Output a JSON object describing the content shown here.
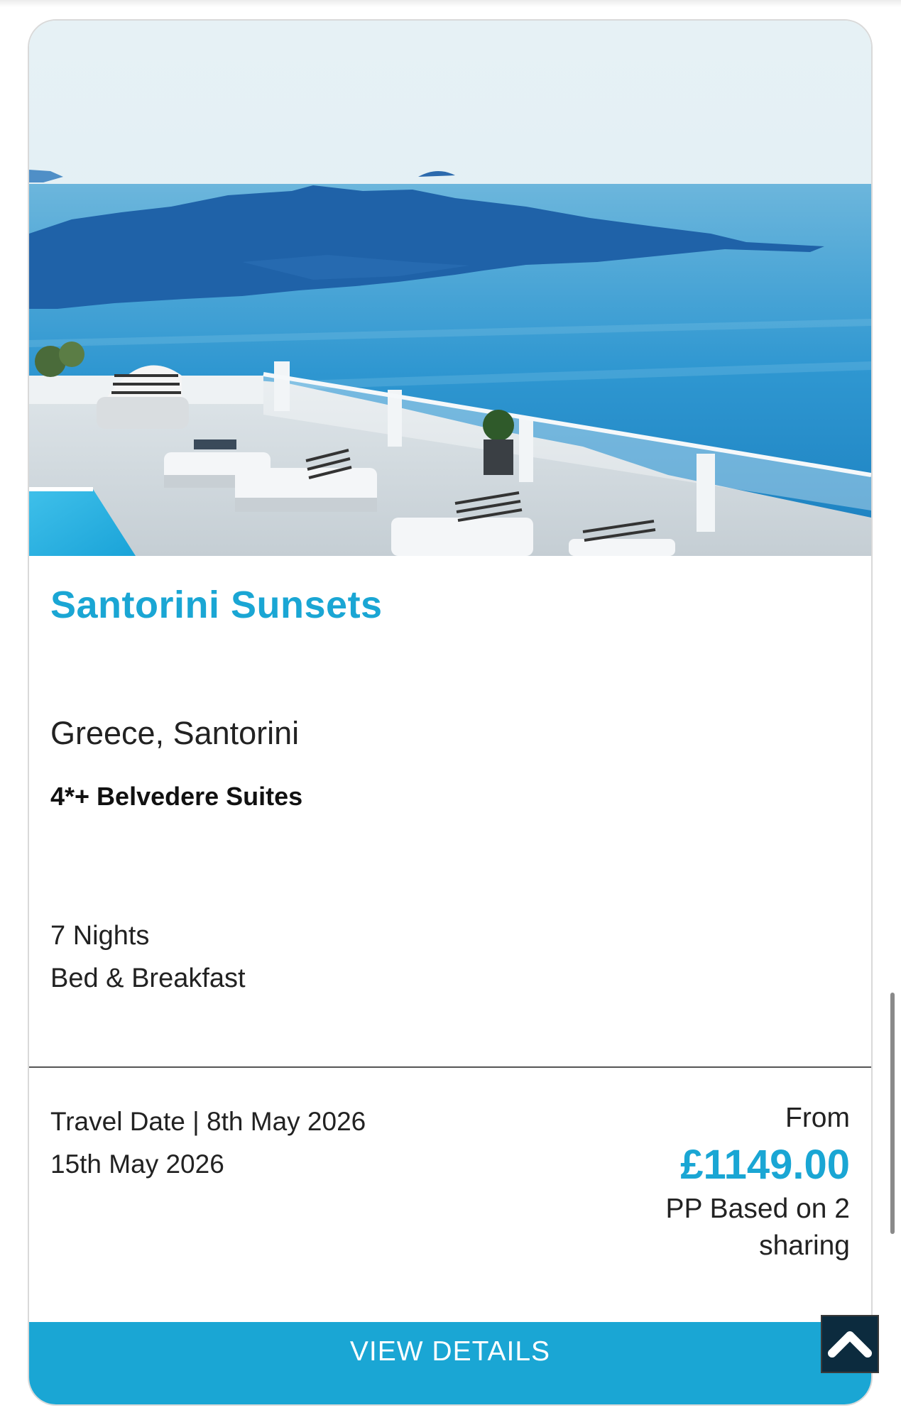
{
  "card": {
    "title": "Santorini Sunsets",
    "location": "Greece, Santorini",
    "hotel": "4*+ Belvedere Suites",
    "duration": "7 Nights",
    "board": "Bed & Breakfast",
    "travel_date": "Travel Date | 8th May 2026",
    "return_date": "15th May 2026",
    "price_prefix": "From",
    "price": "£1149.00",
    "price_note": "PP Based on 2 sharing",
    "cta_label": "VIEW DETAILS"
  },
  "hero_image": {
    "subject": "Santorini caldera view with terrace, sun loungers and pool"
  },
  "icons": {
    "back_to_top": "chevron-up-icon"
  },
  "colors": {
    "accent": "#1aa6d4",
    "back_to_top_bg": "#0c2b3e"
  }
}
